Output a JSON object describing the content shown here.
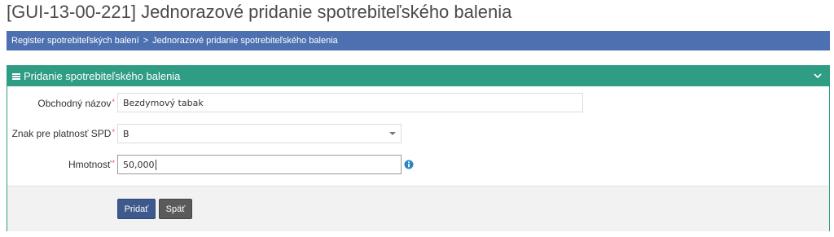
{
  "page": {
    "title": "[GUI-13-00-221] Jednorazové pridanie spotrebiteľského balenia"
  },
  "breadcrumb": {
    "items": [
      "Register spotrebiteľských balení",
      "Jednorazové pridanie spotrebiteľského balenia"
    ],
    "separator": ">"
  },
  "panel": {
    "title": "Pridanie spotrebiteľského balenia",
    "header_color": "#2f9c84",
    "collapse_icon": "chevron-down-icon",
    "menu_icon": "hamburger-icon"
  },
  "form": {
    "required_marker": "*",
    "trade_name": {
      "label": "Obchodný názov",
      "value": "Bezdymový tabak"
    },
    "spd_sign": {
      "label": "Znak pre platnosť SPD",
      "value": "B"
    },
    "weight": {
      "label": "Hmotnosť",
      "value": "50,000",
      "info_icon": "info-icon"
    }
  },
  "actions": {
    "add_label": "Pridať",
    "back_label": "Späť"
  },
  "colors": {
    "breadcrumb_bg": "#4d70b0",
    "panel_accent": "#2f9c84",
    "primary_button": "#3e5a8c",
    "secondary_button": "#5a5a5a",
    "info_icon": "#2a86c9",
    "required": "#d9534f"
  }
}
